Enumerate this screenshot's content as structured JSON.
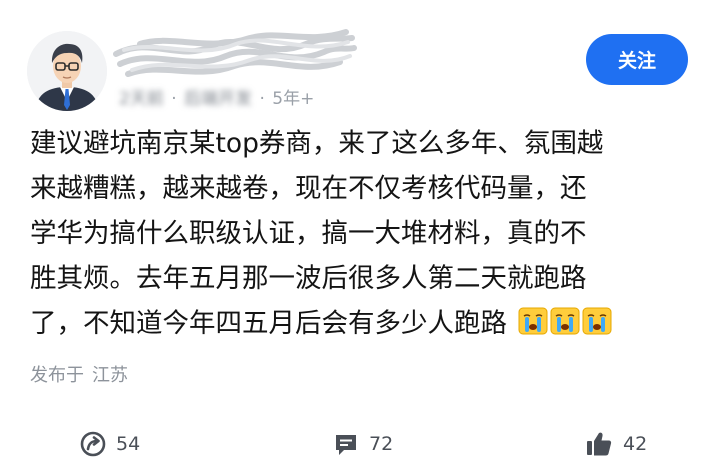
{
  "post": {
    "author_meta": {
      "time": "2天前",
      "level": "5年+",
      "blurred_role": "后端开发"
    },
    "follow_label": "关注",
    "content_lines": [
      "建议避坑南京某top券商，来了这么多年、氛围越",
      "来越糟糕，越来越卷，现在不仅考核代码量，还",
      "学华为搞什么职级认证，搞一大堆材料，真的不",
      "胜其烦。去年五月那一波后很多人第二天就跑路",
      "了，不知道今年四五月后会有多少人跑路"
    ],
    "location_prefix": "发布于",
    "location": "江苏",
    "stats": {
      "shares": "54",
      "comments": "72",
      "likes": "42"
    }
  },
  "colors": {
    "follow_button": "#1f70f2",
    "meta_text": "#9aa0a8",
    "action_text": "#4a4f57"
  },
  "icons": [
    "avatar",
    "crying-emoji",
    "share-icon",
    "comment-icon",
    "thumbs-up-icon"
  ]
}
